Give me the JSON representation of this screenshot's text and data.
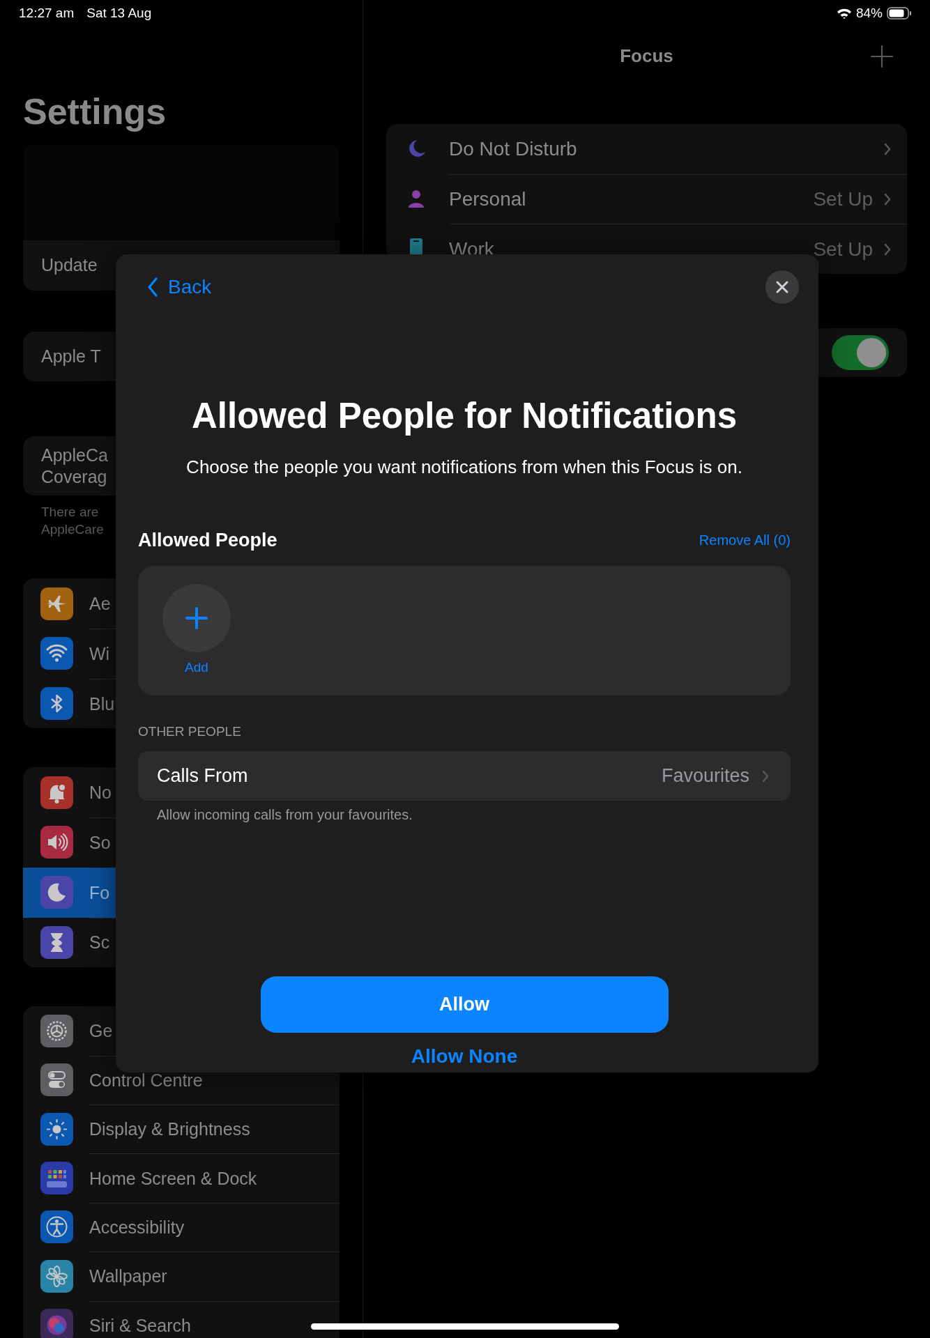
{
  "status_bar": {
    "time": "12:27 am",
    "date": "Sat 13 Aug",
    "battery": "84%"
  },
  "sidebar": {
    "title": "Settings",
    "groups": [
      {
        "kind": "account",
        "items": [
          {
            "lines": [
              "Update"
            ],
            "selected": false
          }
        ]
      },
      {
        "kind": "plain",
        "items": [
          {
            "lines": [
              "Apple T"
            ],
            "selected": false
          }
        ]
      },
      {
        "kind": "plain",
        "items": [
          {
            "lines": [
              "AppleCa",
              "Coverag"
            ],
            "selected": false
          }
        ],
        "footer": [
          "There are",
          "AppleCare"
        ]
      },
      {
        "kind": "icons",
        "items": [
          {
            "lines": [
              "Ae"
            ],
            "selected": false,
            "color": "#a0620f"
          },
          {
            "lines": [
              "Wi"
            ],
            "selected": false,
            "color": "#0b58b0"
          },
          {
            "lines": [
              "Blu"
            ],
            "selected": false,
            "color": "#0b58b0"
          }
        ]
      },
      {
        "kind": "icons",
        "items": [
          {
            "lines": [
              "No"
            ],
            "selected": false,
            "color": "#a8302a"
          },
          {
            "lines": [
              "So"
            ],
            "selected": false,
            "color": "#a82a40"
          },
          {
            "lines": [
              "Fo"
            ],
            "selected": true,
            "color": "#4a45a6"
          },
          {
            "lines": [
              "Sc"
            ],
            "selected": false,
            "color": "#4a45a6"
          }
        ]
      },
      {
        "kind": "icons",
        "items": [
          {
            "lines": [
              "Ge"
            ],
            "selected": false,
            "color": "#5e5e62"
          },
          {
            "lines": [
              "Control Centre"
            ],
            "selected": false,
            "color": "#5e5e62"
          },
          {
            "lines": [
              "Display & Brightness"
            ],
            "selected": false,
            "color": "#0b58b0"
          },
          {
            "lines": [
              "Home Screen & Dock"
            ],
            "selected": false,
            "color": "#2a3aa8"
          },
          {
            "lines": [
              "Accessibility"
            ],
            "selected": false,
            "color": "#0b58b0"
          },
          {
            "lines": [
              "Wallpaper"
            ],
            "selected": false,
            "color": "#2a84a8"
          },
          {
            "lines": [
              "Siri & Search"
            ],
            "selected": false,
            "color": "#3a2a5a"
          }
        ]
      }
    ]
  },
  "detail": {
    "title": "Focus",
    "focus_modes": [
      {
        "label": "Do Not Disturb",
        "color": "#4a45a6"
      },
      {
        "label": "Personal",
        "value": "Set Up",
        "color": "#8a3fa8"
      },
      {
        "label": "Work",
        "value": "Set Up",
        "color": "#1f8090"
      }
    ],
    "toggle": {
      "on": true
    }
  },
  "modal": {
    "back": "Back",
    "title": "Allowed People for Notifications",
    "subtitle": "Choose the people you want notifications from when this Focus is on.",
    "section_title": "Allowed People",
    "remove_all": "Remove All (0)",
    "add_label": "Add",
    "other_header": "OTHER PEOPLE",
    "calls_from": {
      "label": "Calls From",
      "value": "Favourites"
    },
    "calls_footer": "Allow incoming calls from your favourites.",
    "primary_button": "Allow",
    "secondary_button": "Allow None"
  }
}
